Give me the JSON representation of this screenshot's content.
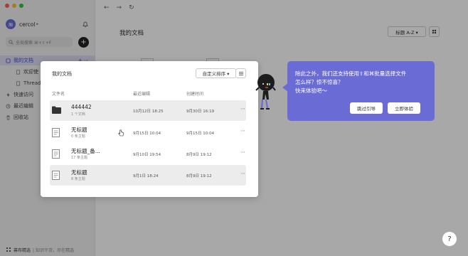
{
  "sidebar": {
    "user": {
      "avatar_initial": "厢",
      "name": "cercol"
    },
    "search": {
      "placeholder": "全局搜索 ⌘+⇧+F"
    },
    "new_button": "+",
    "nav": [
      {
        "label": "我的文档",
        "icon": "doc-icon",
        "active": true
      },
      {
        "label": "欢迎使",
        "icon": "file-icon",
        "sub": true
      },
      {
        "label": "Thread",
        "icon": "file-icon",
        "sub": true
      },
      {
        "label": "快速访问",
        "icon": "lightning-icon"
      },
      {
        "label": "最近编辑",
        "icon": "clock-icon"
      },
      {
        "label": "回收站",
        "icon": "trash-icon"
      }
    ],
    "nav_actions": "+ ⋯",
    "bottom": {
      "label": "幕布精选",
      "sub": "| 知识干货，尽在精选"
    }
  },
  "toolbar": {
    "back": "←",
    "forward": "→",
    "refresh": "↻"
  },
  "main": {
    "title": "我的文档",
    "sort_label": "标题 A-Z ▾"
  },
  "modal": {
    "title": "我的文档",
    "sort_label": "自定义排序 ▾",
    "columns": {
      "name": "文件名",
      "edited": "最近编辑",
      "created": "创建时间"
    },
    "rows": [
      {
        "type": "folder",
        "name": "444442",
        "count": "1 个文档",
        "edited": "10月12日 18:25",
        "created": "9月30日 16:19",
        "more": "⋯",
        "selected": true
      },
      {
        "type": "doc",
        "name": "无标题",
        "count": "0 条主题",
        "edited": "9月15日 10:04",
        "created": "9月15日 10:04",
        "more": "⋯",
        "selected": false
      },
      {
        "type": "doc",
        "name": "无标题_备...",
        "count": "17 条主题",
        "edited": "9月10日 19:54",
        "created": "8月9日 19:12",
        "more": "⋯",
        "selected": false
      },
      {
        "type": "doc",
        "name": "无标题",
        "count": "8 条主题",
        "edited": "9月1日 18:24",
        "created": "8月9日 19:12",
        "more": "⋯",
        "selected": true
      }
    ]
  },
  "guide": {
    "line1": "除此之外，我们还支持使用⇧和⌘批量选择文件",
    "line2": "怎么样？惊不惊喜？",
    "line3": "快来体验吧～",
    "skip": "跳过引导",
    "try": "立即体验"
  },
  "help": "?",
  "colors": {
    "accent": "#6b6bd6",
    "overlay": "rgba(0,0,0,0.34)"
  }
}
